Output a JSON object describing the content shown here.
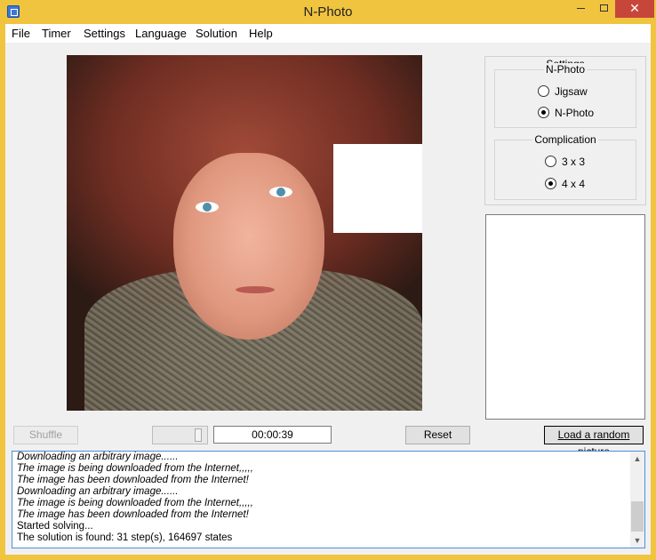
{
  "window": {
    "title": "N-Photo",
    "close_glyph": "✕"
  },
  "menu": [
    "File",
    "Timer",
    "Settings",
    "Language",
    "Solution",
    "Help"
  ],
  "settings": {
    "title": "Settings",
    "mode_group": {
      "legend": "N-Photo",
      "options": [
        {
          "label": "Jigsaw",
          "checked": false
        },
        {
          "label": "N-Photo",
          "checked": true
        }
      ]
    },
    "complication_group": {
      "legend": "Complication",
      "options": [
        {
          "label": "3 x 3",
          "checked": false
        },
        {
          "label": "4 x 4",
          "checked": true
        }
      ]
    }
  },
  "controls": {
    "shuffle_label": "Shuffle",
    "timer_value": "00:00:39",
    "reset_label": "Reset",
    "load_label": "Load a random picture"
  },
  "log": [
    {
      "text": "Downloading an arbitrary image......",
      "italic": true
    },
    {
      "text": "The image is being downloaded from the Internet,,,,,",
      "italic": true
    },
    {
      "text": "The image has been downloaded from the Internet!",
      "italic": true
    },
    {
      "text": "Downloading an arbitrary image......",
      "italic": true
    },
    {
      "text": "The image is being downloaded from the Internet,,,,,",
      "italic": true
    },
    {
      "text": "The image has been downloaded from the Internet!",
      "italic": true
    },
    {
      "text": "Started solving...",
      "italic": false
    },
    {
      "text": "The solution is found: 31 step(s), 164697 states",
      "italic": false
    }
  ],
  "colors": {
    "titlebar": "#f0c43f",
    "close_button": "#c7463a",
    "log_border": "#4a90d9"
  },
  "icons": [
    "app-icon",
    "minimize-icon",
    "maximize-icon",
    "close-icon",
    "scroll-up-icon",
    "scroll-down-icon"
  ]
}
